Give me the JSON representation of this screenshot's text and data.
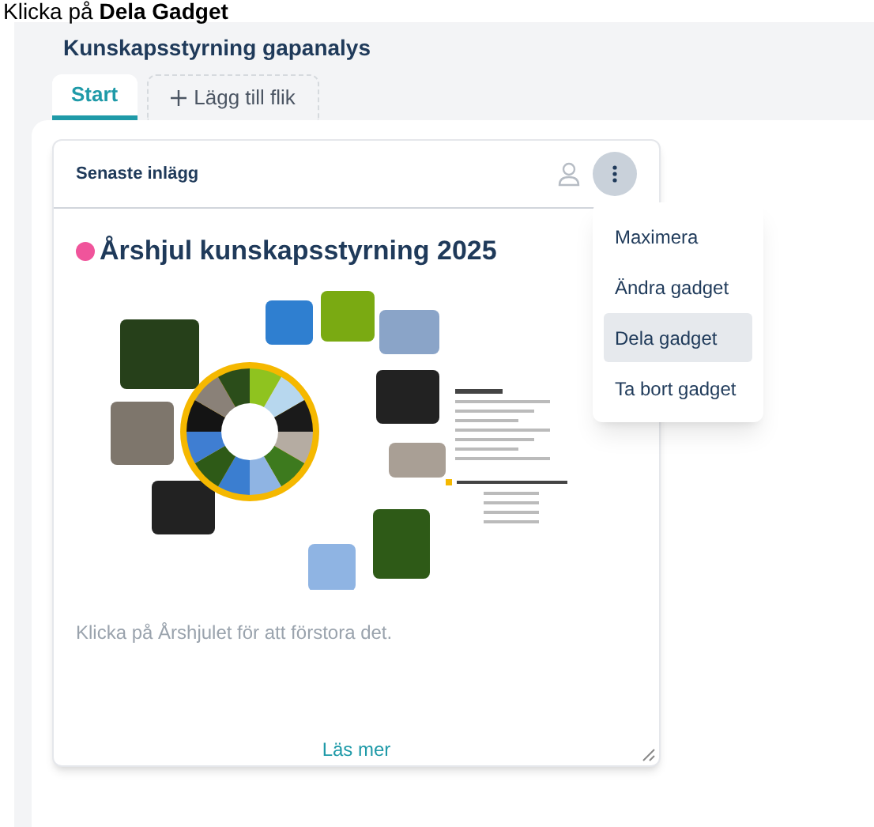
{
  "instruction": "Klicka på **Dela Gadget**",
  "page_title": "Kunskapsstyrning gapanalys",
  "tabs": [
    {
      "label": "Start",
      "selected": true,
      "kind": "tab"
    },
    {
      "label": "Lägg till flik",
      "selected": false,
      "kind": "add"
    }
  ],
  "gadget": {
    "title": "Senaste inlägg",
    "post_title": "Årshjul kunskapsstyrning 2025",
    "caption": "Klicka på Årshjulet för att förstora det.",
    "read_more": "Läs mer"
  },
  "menu": [
    {
      "label": "Maximera",
      "selected": false
    },
    {
      "label": "Ändra gadget",
      "selected": false
    },
    {
      "label": "Dela gadget",
      "selected": true
    },
    {
      "label": "Ta bort gadget",
      "selected": false
    }
  ]
}
